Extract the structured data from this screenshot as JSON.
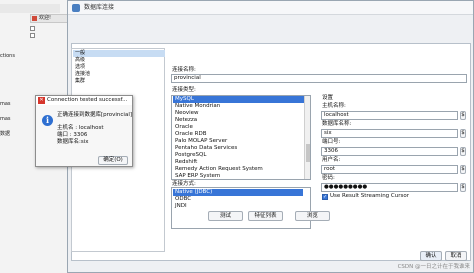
{
  "bg_app": {
    "tab_label": "欢迎!",
    "left_items": [
      "ctions",
      "mas",
      "mas",
      "数据"
    ]
  },
  "dialog": {
    "title": "数据库连接",
    "nav_items": [
      "一般",
      "高级",
      "选项",
      "连接池",
      "集群"
    ],
    "nav_selected_index": 0,
    "connection_name_label": "连接名称:",
    "connection_name_value": "provincial",
    "connection_type_label": "连接类型:",
    "db_types": [
      "MySQL",
      "Native Mondrian",
      "Neoview",
      "Netezza",
      "Oracle",
      "Oracle RDB",
      "Palo MOLAP Server",
      "Pentaho Data Services",
      "PostgreSQL",
      "Redshift",
      "Remedy Action Request System",
      "SAP ERP System"
    ],
    "db_selected": "MySQL",
    "access_label": "连接方式:",
    "access_methods": [
      "Native (JDBC)",
      "ODBC",
      "JNDI"
    ],
    "access_selected": "Native (JDBC)",
    "settings_label": "设置",
    "host_label": "主机名称:",
    "host_value": "localhost",
    "dbname_label": "数据库名称:",
    "dbname_value": "six",
    "port_label": "端口号:",
    "port_value": "3306",
    "user_label": "用户名:",
    "user_value": "root",
    "password_label": "密码:",
    "password_value": "●●●●●●●●●",
    "streaming_label": "Use Result Streaming Cursor",
    "streaming_checked": true,
    "buttons": {
      "test": "测试",
      "features": "特征列表",
      "explore": "浏览"
    },
    "ok_label": "确认",
    "cancel_label": "取消"
  },
  "popup": {
    "title": "Connection tested successf...",
    "message_line1": "正确连接到数据库[provincial]",
    "host_line": "主机名   : localhost",
    "port_line": "端口      : 3306",
    "db_line": "数据库名:six",
    "ok_label": "确定(O)"
  },
  "watermark": "CSDN @一日之计在于我谁来"
}
